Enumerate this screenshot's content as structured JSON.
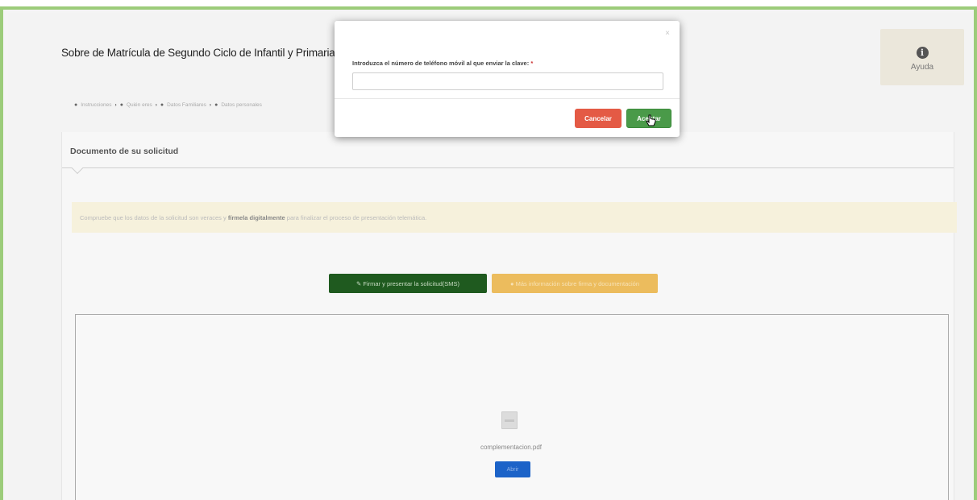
{
  "app": {
    "title": "Sobre de Matrícula de Segundo Ciclo de Infantil y Primaria"
  },
  "help": {
    "icon": "info-icon",
    "label": "Ayuda"
  },
  "breadcrumb": {
    "items": [
      "Instrucciones",
      "Quién eres",
      "Datos Familiares",
      "Datos personales"
    ]
  },
  "panel": {
    "title": "Documento de su solicitud"
  },
  "notice": {
    "text_before": "Compruebe que los datos de la solicitud son veraces y ",
    "emphasis": "fírmela digitalmente",
    "text_after": " para finalizar el proceso de presentación telemática."
  },
  "actions": {
    "sign_label": "Firmar y presentar la solicitud(SMS)",
    "alt_label": "Más información sobre firma y documentación"
  },
  "viewer": {
    "file_name": "complementacion.pdf",
    "open_label": "Abrir"
  },
  "modal": {
    "close_glyph": "×",
    "field_label": "Introduzca el número de teléfono móvil al que enviar la clave:",
    "required_mark": "*",
    "phone_value": "",
    "cancel_label": "Cancelar",
    "accept_label": "Aceptar"
  },
  "colors": {
    "frame_border": "#9ccc7a",
    "cancel_btn": "#e45a45",
    "accept_btn": "#4a9a49",
    "sign_btn": "#1f5a1f",
    "alt_btn": "#ecbc5d",
    "open_btn": "#1c63c8",
    "notice_bg": "#f6f1dc"
  }
}
